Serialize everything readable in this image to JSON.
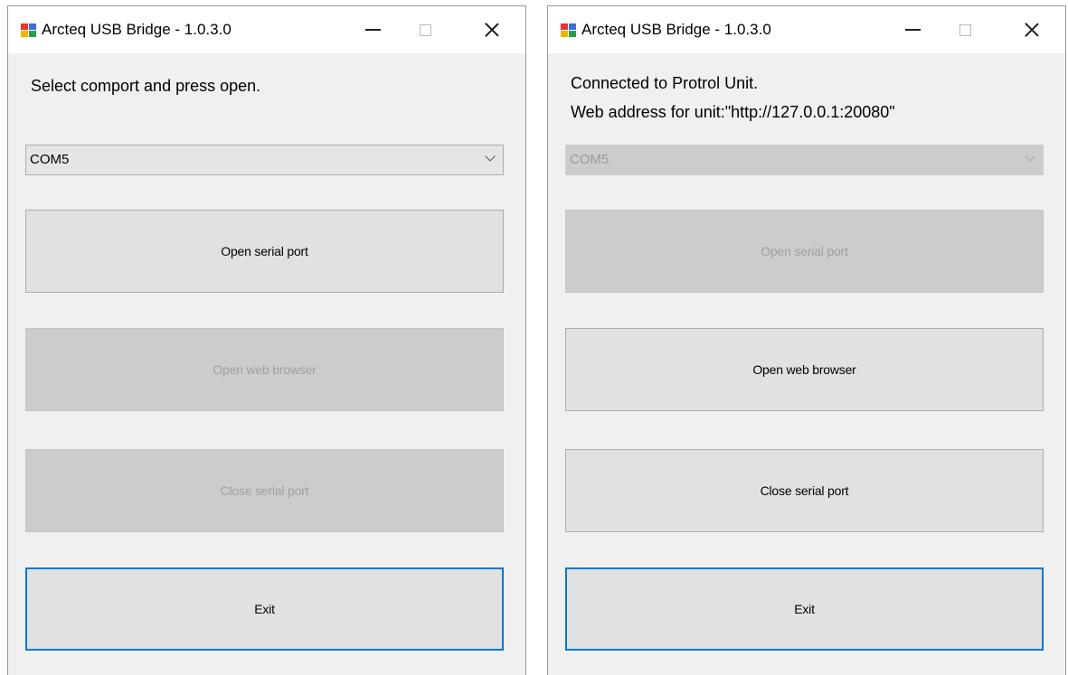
{
  "left_window": {
    "title": "Arcteq USB Bridge - 1.0.3.0",
    "status_line1": "Select comport and press open.",
    "comport_value": "COM5",
    "buttons": {
      "open_serial": "Open serial port",
      "open_browser": "Open web browser",
      "close_serial": "Close serial port",
      "exit": "Exit"
    }
  },
  "right_window": {
    "title": "Arcteq USB Bridge - 1.0.3.0",
    "status_line1": "Connected to Protrol Unit.",
    "status_line2": "Web address for unit:\"http://127.0.0.1:20080\"",
    "comport_value": "COM5",
    "buttons": {
      "open_serial": "Open serial port",
      "open_browser": "Open web browser",
      "close_serial": "Close serial port",
      "exit": "Exit"
    }
  },
  "colors": {
    "window_bg": "#f0f0f0",
    "button_bg": "#e1e1e1",
    "disabled_bg": "#cccccc",
    "focus_border": "#0078d7"
  },
  "icons": {
    "app": "app-icon",
    "minimize": "minimize-icon",
    "maximize": "maximize-icon",
    "close": "close-icon",
    "dropdown": "chevron-down-icon"
  }
}
